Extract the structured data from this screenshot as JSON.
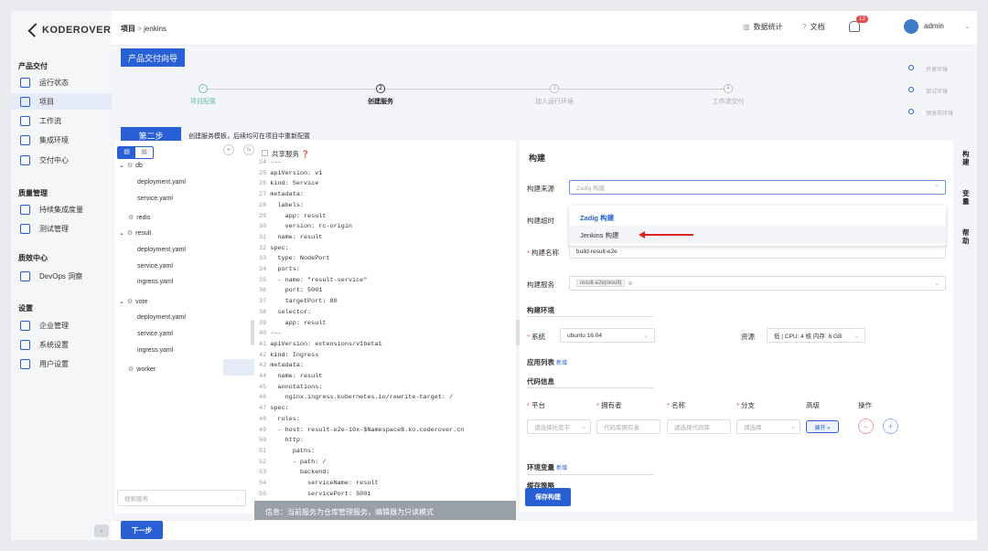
{
  "logo": "KODEROVER",
  "sidebar": {
    "sections": [
      {
        "title": "产品交付",
        "items": [
          "运行状态",
          "项目",
          "工作流",
          "集成环境",
          "交付中心"
        ]
      },
      {
        "title": "质量管理",
        "items": [
          "持续集成度量",
          "测试管理"
        ]
      },
      {
        "title": "质效中心",
        "items": [
          "DevOps 洞察"
        ]
      },
      {
        "title": "设置",
        "items": [
          "企业管理",
          "系统设置",
          "用户设置"
        ]
      }
    ]
  },
  "breadcrumb": {
    "root": "项目",
    "sep": ">",
    "current": "jenkins"
  },
  "header": {
    "stats": "数据统计",
    "docs": "文档",
    "notif_count": "13",
    "user": "admin"
  },
  "wizard": {
    "title": "产品交付向导",
    "steps": [
      {
        "num": "✓",
        "label": "项目配置"
      },
      {
        "num": "2",
        "label": "创建服务"
      },
      {
        "num": "3",
        "label": "加入运行环境"
      },
      {
        "num": "4",
        "label": "工作流交付"
      }
    ],
    "envs": [
      "开发环境",
      "测试环境",
      "预发布环境"
    ],
    "step_badge": "第二步",
    "step_desc": "创建服务模板，后续均可在项目中重新配置"
  },
  "tree": {
    "search_placeholder": "搜索服务",
    "nodes": [
      {
        "label": "db",
        "type": "folder"
      },
      {
        "label": "deployment.yaml",
        "type": "file"
      },
      {
        "label": "service.yaml",
        "type": "file"
      },
      {
        "label": "redis",
        "type": "folder"
      },
      {
        "label": "result",
        "type": "folder"
      },
      {
        "label": "deployment.yaml",
        "type": "file"
      },
      {
        "label": "service.yaml",
        "type": "file"
      },
      {
        "label": "ingress.yaml",
        "type": "file"
      },
      {
        "label": "vote",
        "type": "folder"
      },
      {
        "label": "deployment.yaml",
        "type": "file"
      },
      {
        "label": "service.yaml",
        "type": "file"
      },
      {
        "label": "ingress.yaml",
        "type": "file"
      },
      {
        "label": "worker",
        "type": "folder"
      }
    ]
  },
  "editor": {
    "share": "共享服务",
    "info": "信息：当前服务为仓库管理服务，编辑器为只读模式",
    "lines": [
      [
        "24",
        "---"
      ],
      [
        "25",
        "apiVersion: v1"
      ],
      [
        "26",
        "kind: Service"
      ],
      [
        "27",
        "metadata:"
      ],
      [
        "28",
        "  labels:"
      ],
      [
        "29",
        "    app: result"
      ],
      [
        "30",
        "    version: rc-origin"
      ],
      [
        "31",
        "  name: result"
      ],
      [
        "32",
        "spec:"
      ],
      [
        "33",
        "  type: NodePort"
      ],
      [
        "34",
        "  ports:"
      ],
      [
        "35",
        "  - name: \"result-service\""
      ],
      [
        "36",
        "    port: 5001"
      ],
      [
        "37",
        "    targetPort: 80"
      ],
      [
        "38",
        "  selector:"
      ],
      [
        "39",
        "    app: result"
      ],
      [
        "40",
        "---"
      ],
      [
        "41",
        "apiVersion: extensions/v1beta1"
      ],
      [
        "42",
        "kind: Ingress"
      ],
      [
        "43",
        "metadata:"
      ],
      [
        "44",
        "  name: result"
      ],
      [
        "45",
        "  annotations:"
      ],
      [
        "46",
        "    nginx.ingress.kubernetes.io/rewrite-target: /"
      ],
      [
        "47",
        "spec:"
      ],
      [
        "48",
        "  rules:"
      ],
      [
        "49",
        "  - host: result-e2e-10x-$Namespace$.ko.coderover.cn"
      ],
      [
        "50",
        "    http:"
      ],
      [
        "51",
        "      paths:"
      ],
      [
        "52",
        "      - path: /"
      ],
      [
        "53",
        "        backend:"
      ],
      [
        "54",
        "          serviceName: result"
      ],
      [
        "55",
        "          servicePort: 5001"
      ]
    ]
  },
  "build": {
    "title": "构建",
    "source_label": "构建来源",
    "source_placeholder": "Zadig 构建",
    "options": [
      "Zadig 构建",
      "Jenkins 构建"
    ],
    "timeout_label": "构建超时",
    "name_label": "构建名称",
    "name_value": "build-result-e2e",
    "service_label": "构建服务",
    "service_tag": "result-e2e(result)",
    "env_title": "构建环境",
    "os_label": "系统",
    "os_value": "ubuntu 16.04",
    "res_label": "资源",
    "res_value": "低 | CPU: 4 核 内存: 8 GB",
    "apps_label": "应用列表",
    "add": "新增",
    "code_title": "代码信息",
    "cols": [
      "平台",
      "拥有者",
      "名称",
      "分支",
      "高级",
      "操作"
    ],
    "platform_ph": "请选择托管平",
    "owner_ph": "代码库拥有者",
    "repo_ph": "请选择代码库",
    "branch_ph": "请选择",
    "expand": "展开 »",
    "vars_label": "环境变量",
    "cache_label": "缓存策略",
    "save": "保存构建"
  },
  "right_tabs": [
    "构建",
    "变量",
    "帮助"
  ],
  "next": "下一步"
}
